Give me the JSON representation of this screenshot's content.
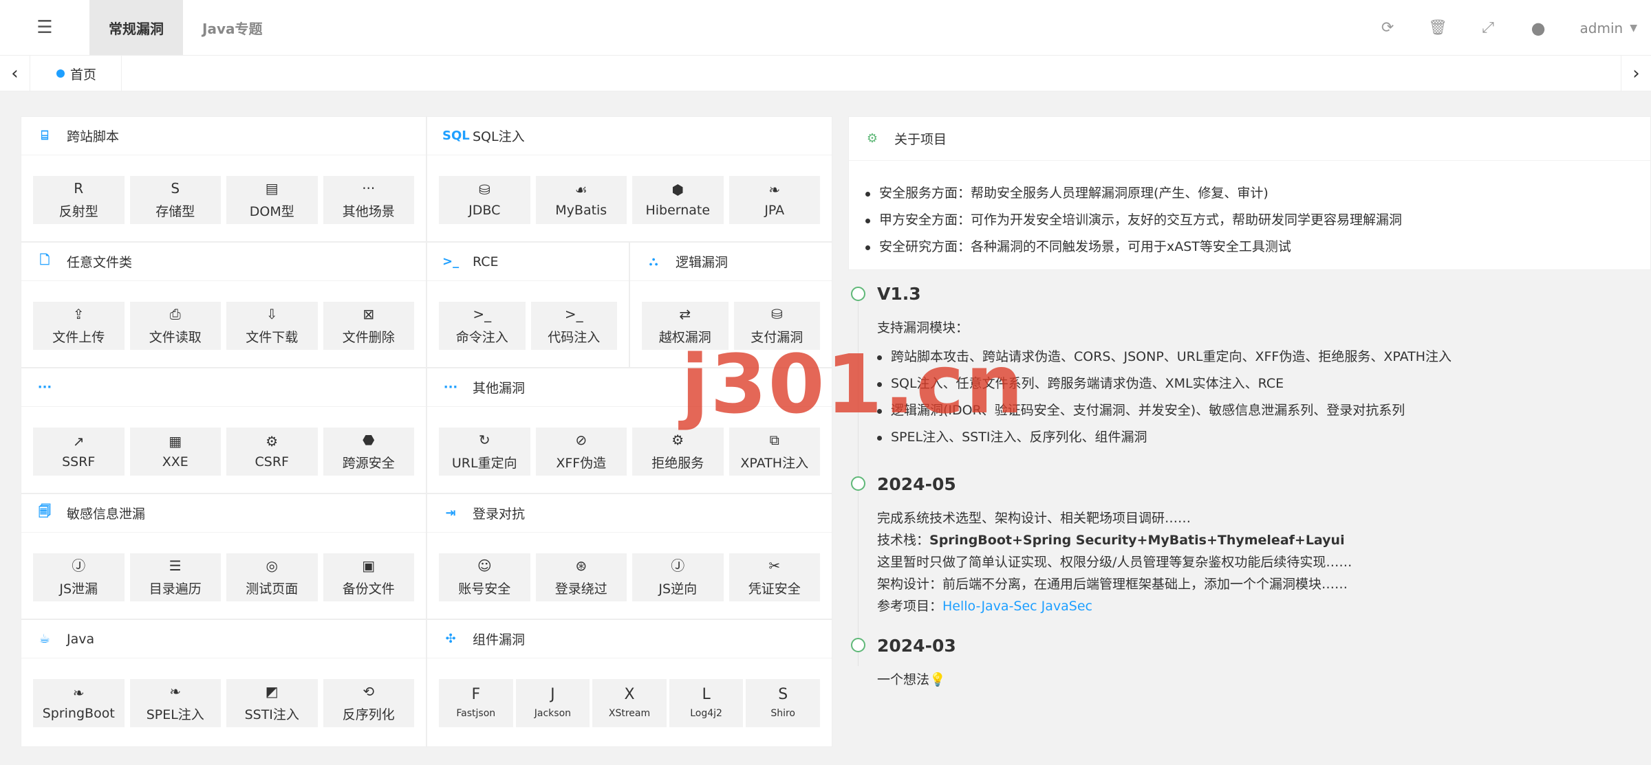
{
  "header": {
    "tabs": [
      "常规漏洞",
      "Java专题"
    ],
    "user": "admin",
    "icons": [
      "refresh-icon",
      "trash-icon",
      "fullscreen-icon",
      "github-icon"
    ]
  },
  "tabsbar": {
    "home_label": "首页"
  },
  "cards": {
    "xss": {
      "title": "跨站脚本",
      "items": [
        {
          "icon": "R",
          "label": "反射型"
        },
        {
          "icon": "S",
          "label": "存储型"
        },
        {
          "icon": "▤",
          "label": "DOM型"
        },
        {
          "icon": "···",
          "label": "其他场景"
        }
      ]
    },
    "sql": {
      "title": "SQL注入",
      "icon": "SQL",
      "items": [
        {
          "icon": "⛁",
          "label": "JDBC"
        },
        {
          "icon": "☙",
          "label": "MyBatis"
        },
        {
          "icon": "⬢",
          "label": "Hibernate"
        },
        {
          "icon": "❧",
          "label": "JPA"
        }
      ]
    },
    "file": {
      "title": "任意文件类",
      "items": [
        {
          "icon": "⇪",
          "label": "文件上传"
        },
        {
          "icon": "⎙",
          "label": "文件读取"
        },
        {
          "icon": "⇩",
          "label": "文件下载"
        },
        {
          "icon": "⊠",
          "label": "文件删除"
        }
      ]
    },
    "rce": {
      "title": "RCE",
      "icon": ">_",
      "items": [
        {
          "icon": ">_",
          "label": "命令注入"
        },
        {
          "icon": ">_",
          "label": "代码注入"
        }
      ]
    },
    "logic": {
      "title": "逻辑漏洞",
      "items": [
        {
          "icon": "⇄",
          "label": "越权漏洞"
        },
        {
          "icon": "⛁",
          "label": "支付漏洞"
        }
      ]
    },
    "misc": {
      "title": "",
      "icon": "···",
      "items": [
        {
          "icon": "↗",
          "label": "SSRF"
        },
        {
          "icon": "▦",
          "label": "XXE"
        },
        {
          "icon": "⚙",
          "label": "CSRF"
        },
        {
          "icon": "⬣",
          "label": "跨源安全"
        }
      ]
    },
    "other": {
      "title": "其他漏洞",
      "icon": "···",
      "items": [
        {
          "icon": "↻",
          "label": "URL重定向"
        },
        {
          "icon": "⊘",
          "label": "XFF伪造"
        },
        {
          "icon": "⚙",
          "label": "拒绝服务"
        },
        {
          "icon": "⧉",
          "label": "XPATH注入"
        }
      ]
    },
    "info": {
      "title": "敏感信息泄漏",
      "items": [
        {
          "icon": "Ⓙ",
          "label": "JS泄漏"
        },
        {
          "icon": "☰",
          "label": "目录遍历"
        },
        {
          "icon": "◎",
          "label": "测试页面"
        },
        {
          "icon": "▣",
          "label": "备份文件"
        }
      ]
    },
    "login": {
      "title": "登录对抗",
      "items": [
        {
          "icon": "☺",
          "label": "账号安全"
        },
        {
          "icon": "⊛",
          "label": "登录绕过"
        },
        {
          "icon": "Ⓙ",
          "label": "JS逆向"
        },
        {
          "icon": "✂",
          "label": "凭证安全"
        }
      ]
    },
    "java": {
      "title": "Java",
      "items": [
        {
          "icon": "❧",
          "label": "SpringBoot"
        },
        {
          "icon": "❧",
          "label": "SPEL注入"
        },
        {
          "icon": "◩",
          "label": "SSTI注入"
        },
        {
          "icon": "⟲",
          "label": "反序列化"
        }
      ]
    },
    "comp": {
      "title": "组件漏洞",
      "items": [
        {
          "icon": "F",
          "label": "Fastjson"
        },
        {
          "icon": "J",
          "label": "Jackson"
        },
        {
          "icon": "X",
          "label": "XStream"
        },
        {
          "icon": "L",
          "label": "Log4j2"
        },
        {
          "icon": "S",
          "label": "Shiro"
        }
      ]
    }
  },
  "about": {
    "title": "关于项目",
    "items": [
      "安全服务方面：帮助安全服务人员理解漏洞原理(产生、修复、审计)",
      "甲方安全方面：可作为开发安全培训演示，友好的交互方式，帮助研发同学更容易理解漏洞",
      "安全研究方面：各种漏洞的不同触发场景，可用于xAST等安全工具测试"
    ]
  },
  "timeline": {
    "v13": {
      "title": "V1.3",
      "intro": "支持漏洞模块：",
      "items": [
        "跨站脚本攻击、跨站请求伪造、CORS、JSONP、URL重定向、XFF伪造、拒绝服务、XPATH注入",
        "SQL注入、任意文件系列、跨服务端请求伪造、XML实体注入、RCE",
        "逻辑漏洞(IDOR、验证码安全、支付漏洞、并发安全)、敏感信息泄漏系列、登录对抗系列",
        "SPEL注入、SSTI注入、反序列化、组件漏洞"
      ]
    },
    "m0524": {
      "title": "2024-05",
      "line1": "完成系统技术选型、架构设计、相关靶场项目调研……",
      "stack_label": "技术栈：",
      "stack_value": "SpringBoot+Spring Security+MyBatis+Thymeleaf+Layui",
      "line3": "这里暂时只做了简单认证实现、权限分级/人员管理等复杂鉴权功能后续待实现……",
      "line4": "架构设计：前后端不分离，在通用后端管理框架基础上，添加一个个漏洞模块……",
      "ref_label": "参考项目：",
      "ref_links": "Hello-Java-Sec JavaSec"
    },
    "m0324": {
      "title": "2024-03",
      "line": "一个想法💡"
    }
  },
  "watermark": "j301.cn"
}
